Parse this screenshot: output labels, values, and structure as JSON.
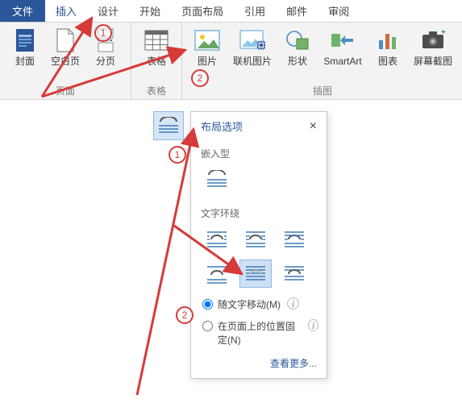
{
  "tabs": {
    "file": "文件",
    "insert": "插入",
    "design": "设计",
    "home": "开始",
    "layout": "页面布局",
    "references": "引用",
    "mailings": "邮件",
    "review": "审阅"
  },
  "ribbon": {
    "pages": {
      "cover": "封面",
      "blank": "空白页",
      "break": "分页",
      "group": "页面"
    },
    "tables": {
      "table": "表格",
      "group": "表格"
    },
    "illustrations": {
      "picture": "图片",
      "online_picture": "联机图片",
      "shapes": "形状",
      "smartart": "SmartArt",
      "chart": "图表",
      "screenshot": "屏幕截图",
      "group": "插图"
    }
  },
  "popup": {
    "title": "布局选项",
    "inline_label": "嵌入型",
    "wrap_label": "文字环绕",
    "move_with_text": "随文字移动(M)",
    "fix_position": "在页面上的位置固定(N)",
    "see_more": "查看更多...",
    "info_tip": "i"
  },
  "annotations": {
    "one": "1",
    "two": "2"
  }
}
